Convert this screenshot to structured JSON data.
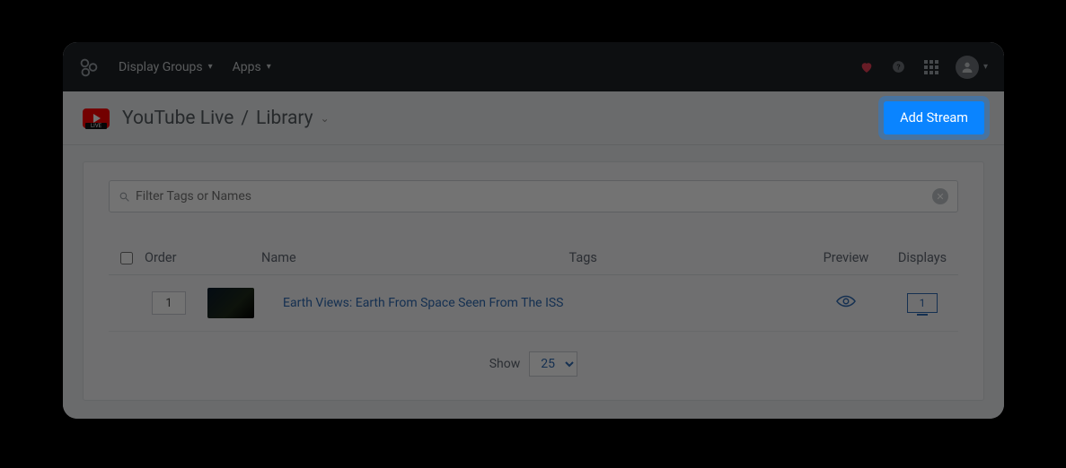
{
  "nav": {
    "display_groups": "Display Groups",
    "apps": "Apps"
  },
  "breadcrumb": {
    "app": "YouTube Live",
    "section": "Library"
  },
  "actions": {
    "add_stream": "Add Stream"
  },
  "search": {
    "placeholder": "Filter Tags or Names"
  },
  "table": {
    "headers": {
      "order": "Order",
      "name": "Name",
      "tags": "Tags",
      "preview": "Preview",
      "displays": "Displays"
    },
    "rows": [
      {
        "order": "1",
        "name": "Earth Views: Earth From Space Seen From The ISS",
        "tags": "",
        "displays": "1"
      }
    ]
  },
  "pager": {
    "label": "Show",
    "value": "25"
  },
  "yt_live_badge": "LIVE"
}
